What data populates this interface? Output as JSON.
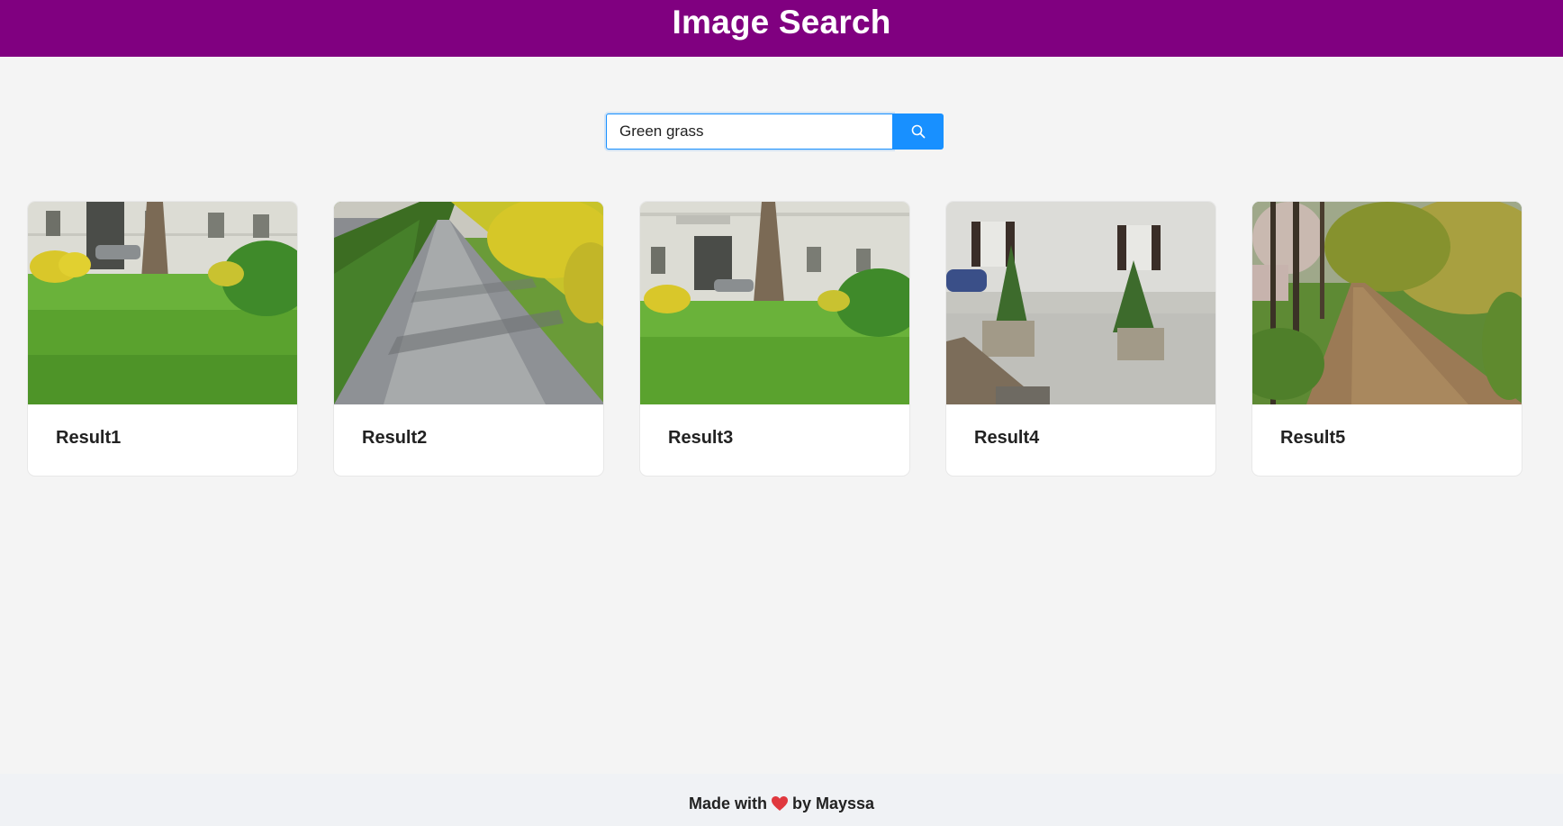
{
  "header": {
    "title": "Image Search"
  },
  "search": {
    "value": "Green grass",
    "button_icon": "search-icon",
    "accent": "#1890ff"
  },
  "results": [
    {
      "title": "Result1",
      "image": "lawn-with-tree-and-building"
    },
    {
      "title": "Result2",
      "image": "paved-path-between-hedges"
    },
    {
      "title": "Result3",
      "image": "lawn-with-tree-and-building"
    },
    {
      "title": "Result4",
      "image": "potted-conifers-by-building"
    },
    {
      "title": "Result5",
      "image": "leafy-dirt-path-in-trees"
    }
  ],
  "footer": {
    "text_before": "Made with",
    "heart_icon": "heart-icon",
    "text_after": "by Mayssa"
  },
  "colors": {
    "header_bg": "#800080",
    "page_bg": "#f4f4f4",
    "footer_bg": "#f0f2f5"
  }
}
